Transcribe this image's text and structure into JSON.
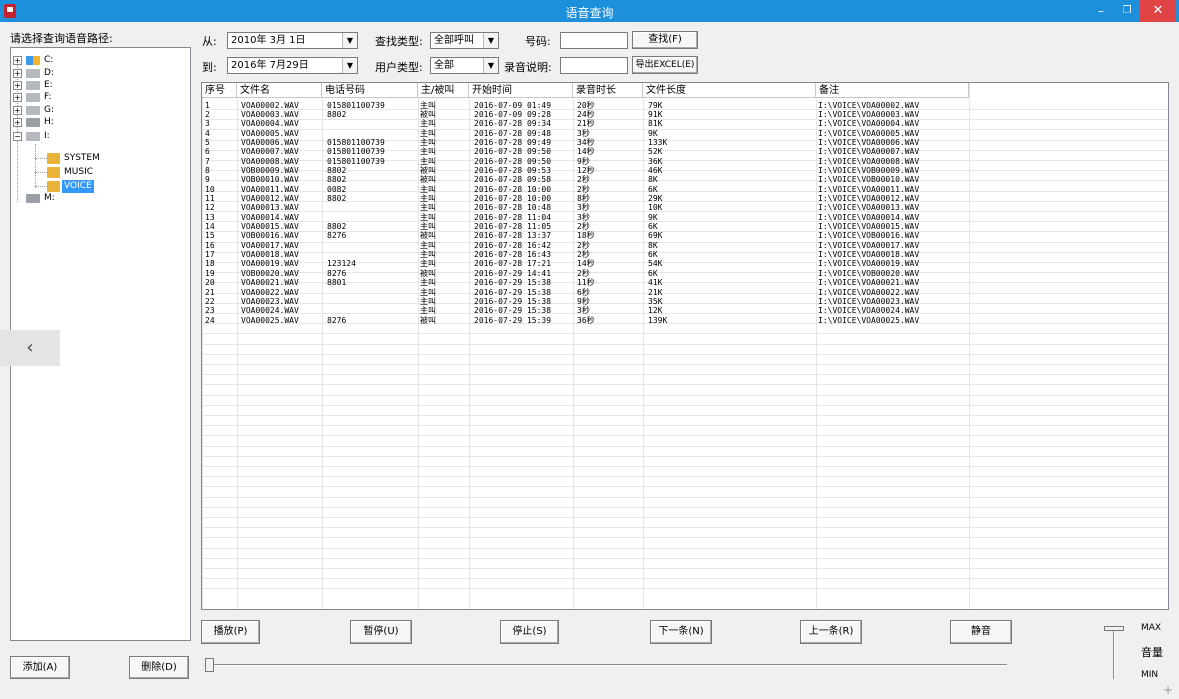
{
  "window": {
    "title": "语音查询",
    "minimize": "–",
    "maximize": "❐",
    "close": "✕"
  },
  "sidebar": {
    "label": "请选择查询语音路径:",
    "drives": [
      "C:",
      "D:",
      "E:",
      "F:",
      "G:",
      "H:",
      "I:",
      "M:"
    ],
    "folders": [
      "SYSTEM",
      "MUSIC",
      "VOICE"
    ],
    "selected": "VOICE",
    "collapse": "‹",
    "expand_plus": "+",
    "expand_minus": "−"
  },
  "filters": {
    "from_label": "从:",
    "from_date": "2010年  3月  1日",
    "to_label": "到:",
    "to_date": "2016年  7月29日",
    "find_type_label": "查找类型:",
    "find_type": "全部呼叫",
    "user_type_label": "用户类型:",
    "user_type": "全部",
    "number_label": "号码:",
    "number_value": "",
    "note_label": "录音说明:",
    "note_value": "",
    "search_button": "查找(F)",
    "export_button": "导出EXCEL(E)",
    "dropdown_arrow": "▼"
  },
  "table": {
    "columns": [
      "序号",
      "文件名",
      "电话号码",
      "主/被叫",
      "开始时间",
      "录音时长",
      "文件长度",
      "备注"
    ],
    "rows": [
      [
        "1",
        "VOA00002.WAV",
        "015801100739",
        "主叫",
        "2016-07-09 01:49",
        "20秒",
        "79K",
        "I:\\VOICE\\VOA00002.WAV"
      ],
      [
        "2",
        "VOA00003.WAV",
        "8802",
        "被叫",
        "2016-07-09 09:28",
        "24秒",
        "91K",
        "I:\\VOICE\\VOA00003.WAV"
      ],
      [
        "3",
        "VOA00004.WAV",
        "",
        "主叫",
        "2016-07-28 09:34",
        "21秒",
        "81K",
        "I:\\VOICE\\VOA00004.WAV"
      ],
      [
        "4",
        "VOA00005.WAV",
        "",
        "主叫",
        "2016-07-28 09:48",
        "3秒",
        "9K",
        "I:\\VOICE\\VOA00005.WAV"
      ],
      [
        "5",
        "VOA00006.WAV",
        "015801100739",
        "主叫",
        "2016-07-28 09:49",
        "34秒",
        "133K",
        "I:\\VOICE\\VOA00006.WAV"
      ],
      [
        "6",
        "VOA00007.WAV",
        "015801100739",
        "主叫",
        "2016-07-28 09:50",
        "14秒",
        "52K",
        "I:\\VOICE\\VOA00007.WAV"
      ],
      [
        "7",
        "VOA00008.WAV",
        "015801100739",
        "主叫",
        "2016-07-28 09:50",
        "9秒",
        "36K",
        "I:\\VOICE\\VOA00008.WAV"
      ],
      [
        "8",
        "VOB00009.WAV",
        "8802",
        "被叫",
        "2016-07-28 09:53",
        "12秒",
        "46K",
        "I:\\VOICE\\VOB00009.WAV"
      ],
      [
        "9",
        "VOB00010.WAV",
        "8802",
        "被叫",
        "2016-07-28 09:58",
        "2秒",
        "8K",
        "I:\\VOICE\\VOB00010.WAV"
      ],
      [
        "10",
        "VOA00011.WAV",
        "0082",
        "主叫",
        "2016-07-28 10:00",
        "2秒",
        "6K",
        "I:\\VOICE\\VOA00011.WAV"
      ],
      [
        "11",
        "VOA00012.WAV",
        "8802",
        "主叫",
        "2016-07-28 10:00",
        "8秒",
        "29K",
        "I:\\VOICE\\VOA00012.WAV"
      ],
      [
        "12",
        "VOA00013.WAV",
        "",
        "主叫",
        "2016-07-28 10:48",
        "3秒",
        "10K",
        "I:\\VOICE\\VOA00013.WAV"
      ],
      [
        "13",
        "VOA00014.WAV",
        "",
        "主叫",
        "2016-07-28 11:04",
        "3秒",
        "9K",
        "I:\\VOICE\\VOA00014.WAV"
      ],
      [
        "14",
        "VOA00015.WAV",
        "8802",
        "主叫",
        "2016-07-28 11:05",
        "2秒",
        "6K",
        "I:\\VOICE\\VOA00015.WAV"
      ],
      [
        "15",
        "VOB00016.WAV",
        "8276",
        "被叫",
        "2016-07-28 13:37",
        "18秒",
        "69K",
        "I:\\VOICE\\VOB00016.WAV"
      ],
      [
        "16",
        "VOA00017.WAV",
        "",
        "主叫",
        "2016-07-28 16:42",
        "2秒",
        "8K",
        "I:\\VOICE\\VOA00017.WAV"
      ],
      [
        "17",
        "VOA00018.WAV",
        "",
        "主叫",
        "2016-07-28 16:43",
        "2秒",
        "6K",
        "I:\\VOICE\\VOA00018.WAV"
      ],
      [
        "18",
        "VOA00019.WAV",
        "123124",
        "主叫",
        "2016-07-28 17:21",
        "14秒",
        "54K",
        "I:\\VOICE\\VOA00019.WAV"
      ],
      [
        "19",
        "VOB00020.WAV",
        "8276",
        "被叫",
        "2016-07-29 14:41",
        "2秒",
        "6K",
        "I:\\VOICE\\VOB00020.WAV"
      ],
      [
        "20",
        "VOA00021.WAV",
        "8801",
        "主叫",
        "2016-07-29 15:38",
        "11秒",
        "41K",
        "I:\\VOICE\\VOA00021.WAV"
      ],
      [
        "21",
        "VOA00022.WAV",
        "",
        "主叫",
        "2016-07-29 15:38",
        "6秒",
        "21K",
        "I:\\VOICE\\VOA00022.WAV"
      ],
      [
        "22",
        "VOA00023.WAV",
        "",
        "主叫",
        "2016-07-29 15:38",
        "9秒",
        "35K",
        "I:\\VOICE\\VOA00023.WAV"
      ],
      [
        "23",
        "VOA00024.WAV",
        "",
        "主叫",
        "2016-07-29 15:38",
        "3秒",
        "12K",
        "I:\\VOICE\\VOA00024.WAV"
      ],
      [
        "24",
        "VOA00025.WAV",
        "8276",
        "被叫",
        "2016-07-29 15:39",
        "36秒",
        "139K",
        "I:\\VOICE\\VOA00025.WAV"
      ]
    ]
  },
  "player": {
    "play": "播放(P)",
    "pause": "暂停(U)",
    "stop": "停止(S)",
    "next": "下一条(N)",
    "prev": "上一条(R)",
    "mute": "静音"
  },
  "volume": {
    "max": "MAX",
    "label": "音量",
    "min": "MIN",
    "level": 1.0
  },
  "bottom": {
    "add": "添加(A)",
    "delete": "删除(D)"
  },
  "playback": {
    "position": 0
  },
  "colors": {
    "titlebar": "#1e8fda",
    "close": "#e04343",
    "selection": "#3399ff"
  }
}
